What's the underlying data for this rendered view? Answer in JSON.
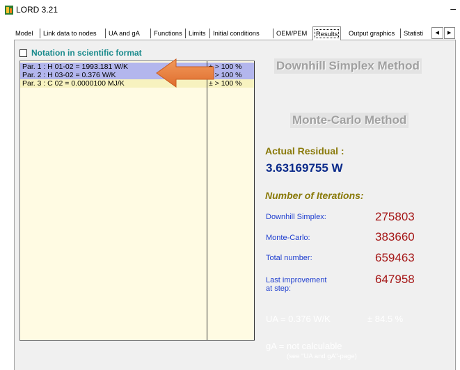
{
  "window": {
    "title": "LORD 3.21",
    "minimize_label": "–"
  },
  "tabs": [
    "Model",
    "Link data to nodes",
    "UA and gA",
    "Functions",
    "Limits",
    "Initial conditions",
    "OEM/PEM",
    "Results",
    "Output graphics",
    "Statisti"
  ],
  "active_tab": "Results",
  "scroll": {
    "left": "◀",
    "right": "▶"
  },
  "notation_label": "Notation in scientific format",
  "parameters": [
    {
      "name": "Par. 1 :  H 01-02 = 1993.181 W/K",
      "error": "± > 100 %"
    },
    {
      "name": "Par. 2 :  H 03-02 = 0.376 W/K",
      "error": "± > 100 %"
    },
    {
      "name": "Par. 3 :  C 02 = 0.0000100 MJ/K",
      "error": "± > 100 %"
    }
  ],
  "methods": {
    "downhill": "Downhill Simplex Method",
    "monte_carlo": "Monte-Carlo Method"
  },
  "residual": {
    "label": "Actual Residual :",
    "value": "3.63169755 W"
  },
  "iterations": {
    "label": "Number of Iterations:",
    "downhill_label": "Downhill Simplex:",
    "downhill_value": "275803",
    "mc_label": "Monte-Carlo:",
    "mc_value": "383660",
    "total_label": "Total number:",
    "total_value": "659463",
    "last_label_1": "Last improvement",
    "last_label_2": "at step:",
    "last_value": "647958"
  },
  "ua": {
    "text": "UA = 0.376 W/K",
    "err": "± 84.5 %"
  },
  "ga": {
    "text": "gA = not calculable",
    "note": "(see \"UA and gA\"-page)"
  },
  "colors": {
    "selection": "#b3b6ed",
    "list_bg": "#fffbe3",
    "value_red": "#a51616",
    "label_blue": "#1e3ecf",
    "olive": "#8a7a0a",
    "arrow": "#e67e3c"
  }
}
